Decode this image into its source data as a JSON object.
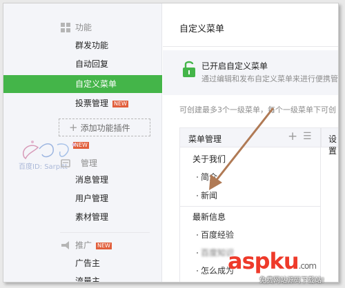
{
  "sidebar": {
    "sections": [
      {
        "label": "功能",
        "icon": "grid-icon"
      },
      {
        "label": "管理",
        "icon": "manage-icon"
      },
      {
        "label": "推广",
        "icon": "megaphone-icon"
      }
    ],
    "function_items": [
      {
        "label": "群发功能"
      },
      {
        "label": "自动回复"
      },
      {
        "label": "自定义菜单",
        "active": true
      },
      {
        "label": "投票管理",
        "badge": "NEW"
      }
    ],
    "add_plugin_label": "添加功能插件",
    "add_plugin_badge": "NEW",
    "manage_items": [
      {
        "label": "消息管理"
      },
      {
        "label": "用户管理"
      },
      {
        "label": "素材管理"
      }
    ],
    "promo_badge": "NEW",
    "promo_items": [
      {
        "label": "广告主"
      },
      {
        "label": "流量主"
      }
    ],
    "watermark_text": "百度ID: Sarpitt"
  },
  "main": {
    "page_title": "自定义菜单",
    "notice": {
      "title": "已开启自定义菜单",
      "subtitle": "通过编辑和发布自定义菜单来进行便携管"
    },
    "hint": "可创建最多3个一级菜单，每个一级菜单下可创",
    "menu_panel": {
      "header": "菜单管理",
      "groups": [
        {
          "label": "关于我们",
          "children": [
            {
              "label": "简介"
            },
            {
              "label": "新闻"
            }
          ]
        },
        {
          "label": "最新信息",
          "children": [
            {
              "label": "百度经验"
            },
            {
              "label": "百度知识"
            },
            {
              "label": "怎么成为"
            }
          ]
        }
      ]
    },
    "settings_header": "设置"
  },
  "overlay": {
    "site_name": "aspku",
    "site_suffix": ".com",
    "site_tagline": "免费网站源码下载站!"
  },
  "colors": {
    "accent": "#44b549",
    "badge": "#e15f3c",
    "arrow": "#b07a55"
  }
}
